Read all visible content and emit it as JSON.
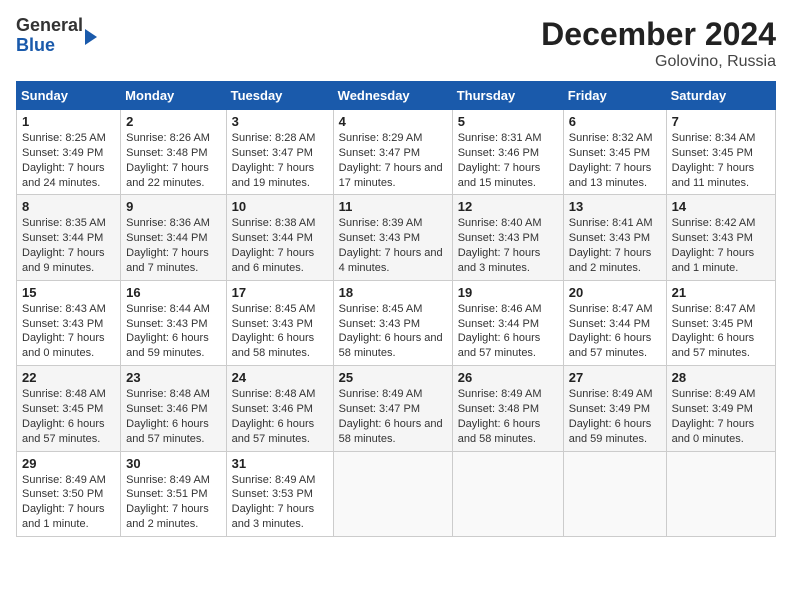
{
  "header": {
    "logo_line1": "General",
    "logo_line2": "Blue",
    "month": "December 2024",
    "location": "Golovino, Russia"
  },
  "columns": [
    "Sunday",
    "Monday",
    "Tuesday",
    "Wednesday",
    "Thursday",
    "Friday",
    "Saturday"
  ],
  "weeks": [
    [
      {
        "day": "1",
        "sunrise": "8:25 AM",
        "sunset": "3:49 PM",
        "daylight": "7 hours and 24 minutes."
      },
      {
        "day": "2",
        "sunrise": "8:26 AM",
        "sunset": "3:48 PM",
        "daylight": "7 hours and 22 minutes."
      },
      {
        "day": "3",
        "sunrise": "8:28 AM",
        "sunset": "3:47 PM",
        "daylight": "7 hours and 19 minutes."
      },
      {
        "day": "4",
        "sunrise": "8:29 AM",
        "sunset": "3:47 PM",
        "daylight": "7 hours and 17 minutes."
      },
      {
        "day": "5",
        "sunrise": "8:31 AM",
        "sunset": "3:46 PM",
        "daylight": "7 hours and 15 minutes."
      },
      {
        "day": "6",
        "sunrise": "8:32 AM",
        "sunset": "3:45 PM",
        "daylight": "7 hours and 13 minutes."
      },
      {
        "day": "7",
        "sunrise": "8:34 AM",
        "sunset": "3:45 PM",
        "daylight": "7 hours and 11 minutes."
      }
    ],
    [
      {
        "day": "8",
        "sunrise": "8:35 AM",
        "sunset": "3:44 PM",
        "daylight": "7 hours and 9 minutes."
      },
      {
        "day": "9",
        "sunrise": "8:36 AM",
        "sunset": "3:44 PM",
        "daylight": "7 hours and 7 minutes."
      },
      {
        "day": "10",
        "sunrise": "8:38 AM",
        "sunset": "3:44 PM",
        "daylight": "7 hours and 6 minutes."
      },
      {
        "day": "11",
        "sunrise": "8:39 AM",
        "sunset": "3:43 PM",
        "daylight": "7 hours and 4 minutes."
      },
      {
        "day": "12",
        "sunrise": "8:40 AM",
        "sunset": "3:43 PM",
        "daylight": "7 hours and 3 minutes."
      },
      {
        "day": "13",
        "sunrise": "8:41 AM",
        "sunset": "3:43 PM",
        "daylight": "7 hours and 2 minutes."
      },
      {
        "day": "14",
        "sunrise": "8:42 AM",
        "sunset": "3:43 PM",
        "daylight": "7 hours and 1 minute."
      }
    ],
    [
      {
        "day": "15",
        "sunrise": "8:43 AM",
        "sunset": "3:43 PM",
        "daylight": "7 hours and 0 minutes."
      },
      {
        "day": "16",
        "sunrise": "8:44 AM",
        "sunset": "3:43 PM",
        "daylight": "6 hours and 59 minutes."
      },
      {
        "day": "17",
        "sunrise": "8:45 AM",
        "sunset": "3:43 PM",
        "daylight": "6 hours and 58 minutes."
      },
      {
        "day": "18",
        "sunrise": "8:45 AM",
        "sunset": "3:43 PM",
        "daylight": "6 hours and 58 minutes."
      },
      {
        "day": "19",
        "sunrise": "8:46 AM",
        "sunset": "3:44 PM",
        "daylight": "6 hours and 57 minutes."
      },
      {
        "day": "20",
        "sunrise": "8:47 AM",
        "sunset": "3:44 PM",
        "daylight": "6 hours and 57 minutes."
      },
      {
        "day": "21",
        "sunrise": "8:47 AM",
        "sunset": "3:45 PM",
        "daylight": "6 hours and 57 minutes."
      }
    ],
    [
      {
        "day": "22",
        "sunrise": "8:48 AM",
        "sunset": "3:45 PM",
        "daylight": "6 hours and 57 minutes."
      },
      {
        "day": "23",
        "sunrise": "8:48 AM",
        "sunset": "3:46 PM",
        "daylight": "6 hours and 57 minutes."
      },
      {
        "day": "24",
        "sunrise": "8:48 AM",
        "sunset": "3:46 PM",
        "daylight": "6 hours and 57 minutes."
      },
      {
        "day": "25",
        "sunrise": "8:49 AM",
        "sunset": "3:47 PM",
        "daylight": "6 hours and 58 minutes."
      },
      {
        "day": "26",
        "sunrise": "8:49 AM",
        "sunset": "3:48 PM",
        "daylight": "6 hours and 58 minutes."
      },
      {
        "day": "27",
        "sunrise": "8:49 AM",
        "sunset": "3:49 PM",
        "daylight": "6 hours and 59 minutes."
      },
      {
        "day": "28",
        "sunrise": "8:49 AM",
        "sunset": "3:49 PM",
        "daylight": "7 hours and 0 minutes."
      }
    ],
    [
      {
        "day": "29",
        "sunrise": "8:49 AM",
        "sunset": "3:50 PM",
        "daylight": "7 hours and 1 minute."
      },
      {
        "day": "30",
        "sunrise": "8:49 AM",
        "sunset": "3:51 PM",
        "daylight": "7 hours and 2 minutes."
      },
      {
        "day": "31",
        "sunrise": "8:49 AM",
        "sunset": "3:53 PM",
        "daylight": "7 hours and 3 minutes."
      },
      null,
      null,
      null,
      null
    ]
  ]
}
